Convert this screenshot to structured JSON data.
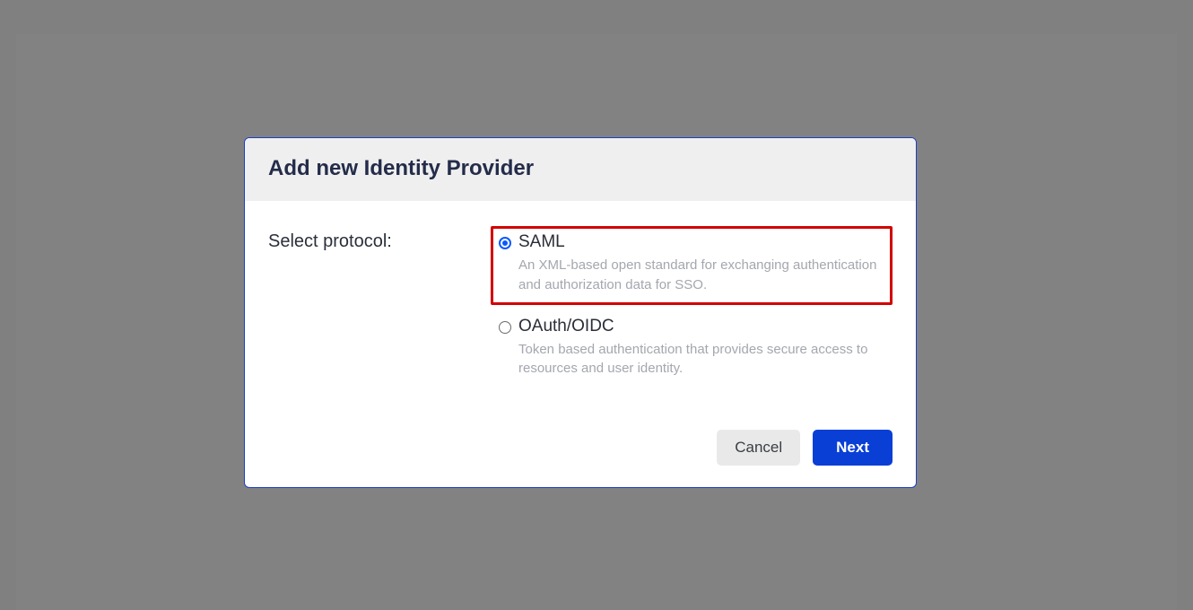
{
  "dialog": {
    "title": "Add new Identity Provider",
    "field_label": "Select protocol:",
    "options": [
      {
        "label": "SAML",
        "description": "An XML-based open standard for exchanging authentication and authorization data for SSO.",
        "selected": true,
        "highlighted": true
      },
      {
        "label": "OAuth/OIDC",
        "description": "Token based authentication that provides secure access to resources and user identity.",
        "selected": false,
        "highlighted": false
      }
    ],
    "buttons": {
      "cancel": "Cancel",
      "next": "Next"
    }
  }
}
